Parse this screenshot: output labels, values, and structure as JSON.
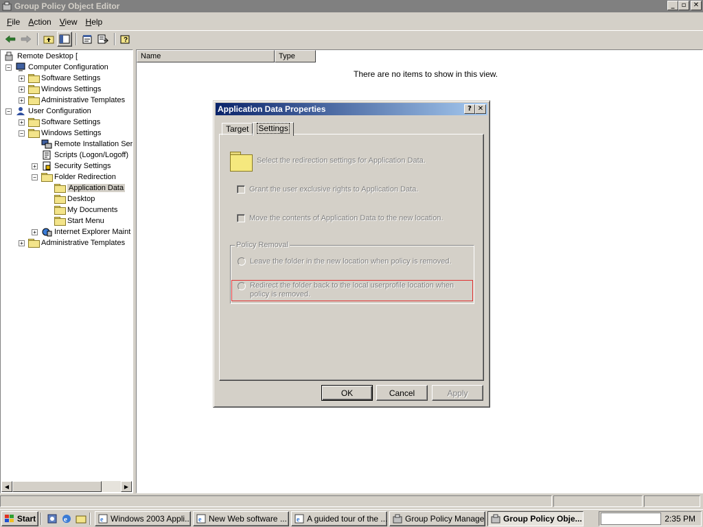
{
  "window": {
    "title": "Group Policy Object Editor",
    "controls": {
      "minimize": "_",
      "maximize": "▫",
      "close": "✕"
    }
  },
  "menu": {
    "items": [
      {
        "label": "File",
        "accel": "F",
        "rest": "ile"
      },
      {
        "label": "Action",
        "accel": "A",
        "rest": "ction"
      },
      {
        "label": "View",
        "accel": "V",
        "rest": "iew"
      },
      {
        "label": "Help",
        "accel": "H",
        "rest": "elp"
      }
    ]
  },
  "tree": {
    "root": "Remote Desktop [",
    "items": [
      {
        "label": "Computer Configuration",
        "level": 1,
        "expander": "−",
        "icon": "computer-icon"
      },
      {
        "label": "Software Settings",
        "level": 2,
        "expander": "+",
        "icon": "folder-icon"
      },
      {
        "label": "Windows Settings",
        "level": 2,
        "expander": "+",
        "icon": "folder-icon"
      },
      {
        "label": "Administrative Templates",
        "level": 2,
        "expander": "+",
        "icon": "folder-icon"
      },
      {
        "label": "User Configuration",
        "level": 1,
        "expander": "−",
        "icon": "user-icon"
      },
      {
        "label": "Software Settings",
        "level": 2,
        "expander": "+",
        "icon": "folder-icon"
      },
      {
        "label": "Windows Settings",
        "level": 2,
        "expander": "−",
        "icon": "folder-icon"
      },
      {
        "label": "Remote Installation Ser",
        "level": 3,
        "expander": "",
        "icon": "remote-install-icon"
      },
      {
        "label": "Scripts (Logon/Logoff)",
        "level": 3,
        "expander": "",
        "icon": "script-icon"
      },
      {
        "label": "Security Settings",
        "level": 3,
        "expander": "+",
        "icon": "security-icon"
      },
      {
        "label": "Folder Redirection",
        "level": 3,
        "expander": "−",
        "icon": "folder-icon"
      },
      {
        "label": "Application Data",
        "level": 4,
        "expander": "",
        "icon": "folder-open-icon",
        "selected": true
      },
      {
        "label": "Desktop",
        "level": 4,
        "expander": "",
        "icon": "folder-icon"
      },
      {
        "label": "My Documents",
        "level": 4,
        "expander": "",
        "icon": "folder-icon"
      },
      {
        "label": "Start Menu",
        "level": 4,
        "expander": "",
        "icon": "folder-icon"
      },
      {
        "label": "Internet Explorer Maint",
        "level": 3,
        "expander": "+",
        "icon": "ie-maint-icon"
      },
      {
        "label": "Administrative Templates",
        "level": 2,
        "expander": "+",
        "icon": "folder-icon"
      }
    ]
  },
  "list": {
    "columns": [
      "Name",
      "Type"
    ],
    "empty_message": "There are no items to show in this view."
  },
  "dialog": {
    "title": "Application Data Properties",
    "help": "?",
    "close": "✕",
    "tabs": [
      {
        "label": "Target",
        "active": false
      },
      {
        "label": "Settings",
        "active": true
      }
    ],
    "description": "Select the redirection settings for Application Data.",
    "checkbox_exclusive": "Grant the user exclusive rights to Application Data.",
    "checkbox_move": "Move the contents of Application Data to the new location.",
    "policy_group": "Policy Removal",
    "radio_leave": "Leave the folder in the new location when policy is removed.",
    "radio_redirect": "Redirect the folder back to the local userprofile location when policy is removed.",
    "buttons": {
      "ok": "OK",
      "cancel": "Cancel",
      "apply": "Apply"
    }
  },
  "taskbar": {
    "start": "Start",
    "tasks": [
      {
        "label": "Windows 2003 Appli...",
        "icon": "ie-icon",
        "active": false
      },
      {
        "label": "New Web software ...",
        "icon": "ie-icon",
        "active": false
      },
      {
        "label": "A guided tour of the ...",
        "icon": "ie-icon",
        "active": false
      },
      {
        "label": "Group Policy Manage...",
        "icon": "gpm-icon",
        "active": false
      },
      {
        "label": "Group Policy Obje...",
        "icon": "gpo-icon",
        "active": true
      }
    ],
    "clock": "2:35 PM"
  },
  "colors": {
    "dialog_title_start": "#0a246a",
    "dialog_title_end": "#a6caf0",
    "highlight": "#e03030"
  }
}
